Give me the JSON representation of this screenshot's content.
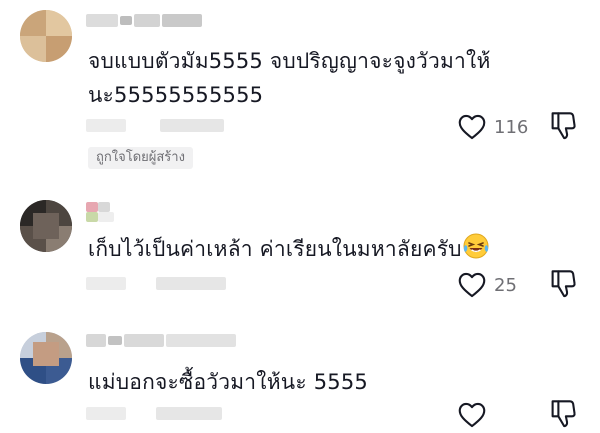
{
  "comments": [
    {
      "text": "จบแบบตัวมัม5555 จบปริญญาจะจูงวัวมาให้นะ55555555555",
      "likes": "116",
      "creator_badge": "ถูกใจโดยผู้สร้าง"
    },
    {
      "text": "เก็บไว้เป็นค่าเหล้า ค่าเรียนในมหาลัยครับ",
      "emoji": "laughing-tears-emoji",
      "likes": "25"
    },
    {
      "text": "แม่บอกจะซื้อวัวมาให้นะ 5555",
      "likes": ""
    }
  ],
  "icons": {
    "like": "heart-outline-icon",
    "dislike": "thumbs-down-icon"
  },
  "colors": {
    "text": "#161823",
    "meta": "#6f6f74",
    "badge_bg": "#f1f1f2"
  }
}
